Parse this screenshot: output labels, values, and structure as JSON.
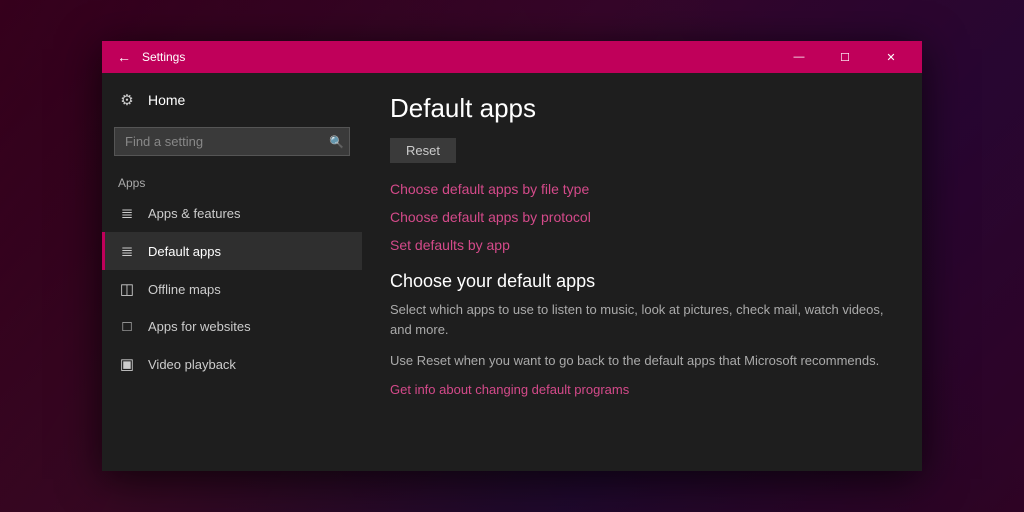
{
  "window": {
    "title": "Settings",
    "controls": {
      "minimize": "—",
      "maximize": "☐",
      "close": "✕"
    }
  },
  "sidebar": {
    "home_label": "Home",
    "search_placeholder": "Find a setting",
    "search_icon": "🔍",
    "apps_section_label": "Apps",
    "items": [
      {
        "id": "apps-features",
        "label": "Apps & features",
        "icon": "≡"
      },
      {
        "id": "default-apps",
        "label": "Default apps",
        "icon": "≔",
        "active": true
      },
      {
        "id": "offline-maps",
        "label": "Offline maps",
        "icon": "⊞"
      },
      {
        "id": "apps-websites",
        "label": "Apps for websites",
        "icon": "⊡"
      },
      {
        "id": "video-playback",
        "label": "Video playback",
        "icon": "⊟"
      }
    ]
  },
  "main": {
    "page_title": "Default apps",
    "reset_button": "Reset",
    "links": [
      {
        "id": "link-file-type",
        "text": "Choose default apps by file type"
      },
      {
        "id": "link-protocol",
        "text": "Choose default apps by protocol"
      },
      {
        "id": "link-set-defaults",
        "text": "Set defaults by app"
      }
    ],
    "section_title": "Choose your default apps",
    "section_desc": "Select which apps to use to listen to music, look at pictures, check mail, watch videos, and more.",
    "section_note": "Use Reset when you want to go back to the default apps that Microsoft recommends.",
    "info_link": "Get info about changing default programs"
  }
}
